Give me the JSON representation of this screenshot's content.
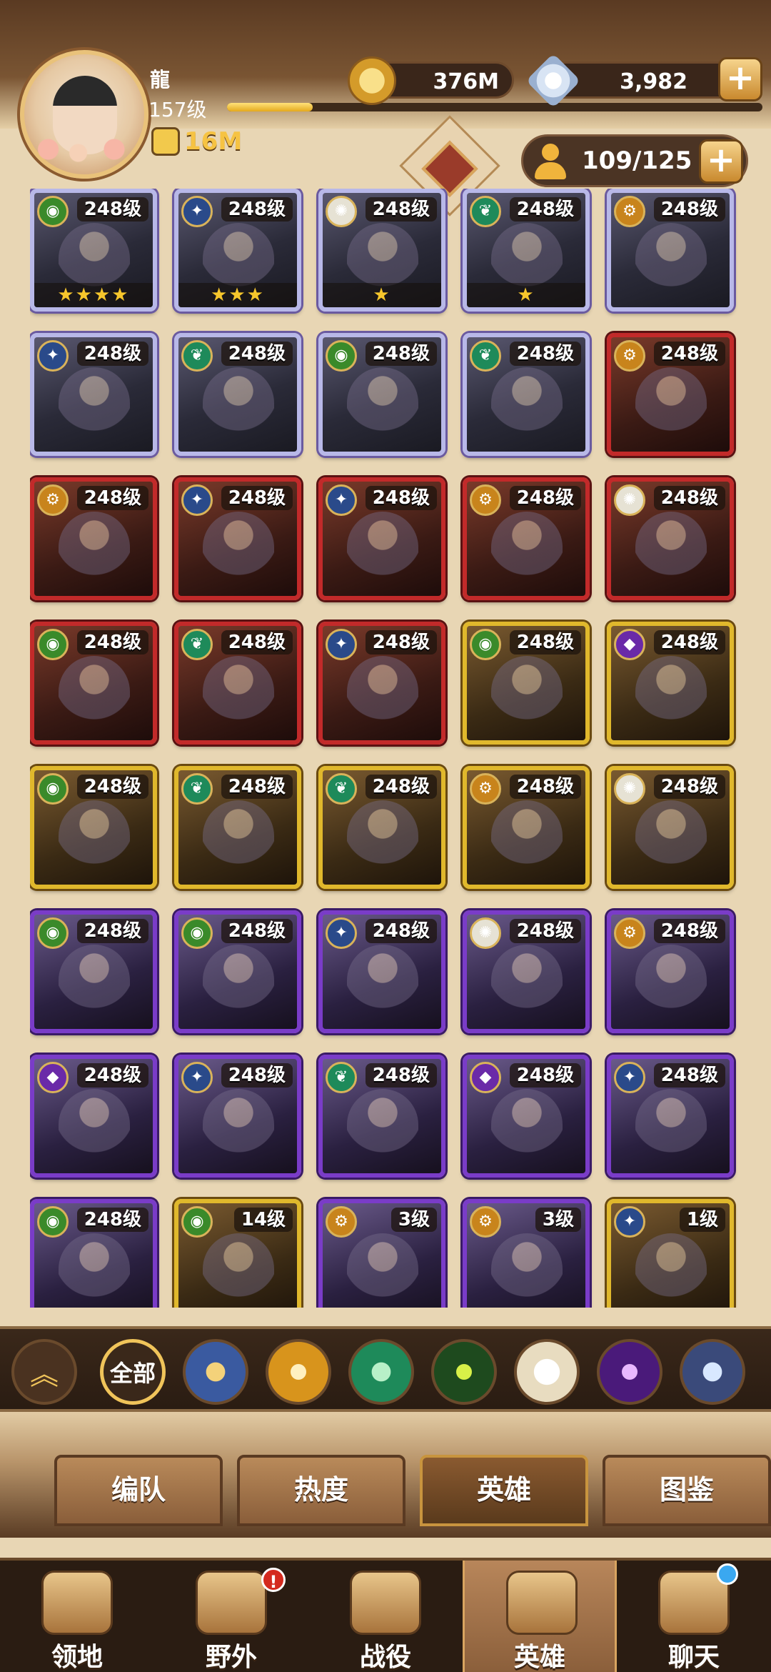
{
  "player": {
    "name": "龍",
    "level": "157级",
    "xp_progress": 0.16,
    "power": "16M"
  },
  "resources": {
    "gold": "376M",
    "diamonds": "3,982"
  },
  "hero_count": "109/125",
  "heroes": [
    {
      "level": "248级",
      "stars": "★★★★",
      "faction": "forest",
      "tier": "purple-white"
    },
    {
      "level": "248级",
      "stars": "★★★",
      "faction": "light",
      "tier": "purple-white"
    },
    {
      "level": "248级",
      "stars": "★",
      "faction": "celestial",
      "tier": "purple-white"
    },
    {
      "level": "248级",
      "stars": "★",
      "faction": "wilder",
      "tier": "purple-white"
    },
    {
      "level": "248级",
      "stars": "",
      "faction": "graveborn",
      "tier": "purple-white"
    },
    {
      "level": "248级",
      "stars": "",
      "faction": "light",
      "tier": "purple-white"
    },
    {
      "level": "248级",
      "stars": "",
      "faction": "wilder",
      "tier": "purple-white"
    },
    {
      "level": "248级",
      "stars": "",
      "faction": "forest",
      "tier": "purple-white"
    },
    {
      "level": "248级",
      "stars": "",
      "faction": "wilder",
      "tier": "purple-white"
    },
    {
      "level": "248级",
      "stars": "",
      "faction": "graveborn",
      "tier": "red"
    },
    {
      "level": "248级",
      "stars": "",
      "faction": "graveborn",
      "tier": "red"
    },
    {
      "level": "248级",
      "stars": "",
      "faction": "light",
      "tier": "red"
    },
    {
      "level": "248级",
      "stars": "",
      "faction": "light",
      "tier": "red"
    },
    {
      "level": "248级",
      "stars": "",
      "faction": "graveborn",
      "tier": "red"
    },
    {
      "level": "248级",
      "stars": "",
      "faction": "celestial",
      "tier": "red"
    },
    {
      "level": "248级",
      "stars": "",
      "faction": "forest",
      "tier": "red"
    },
    {
      "level": "248级",
      "stars": "",
      "faction": "wilder",
      "tier": "red"
    },
    {
      "level": "248级",
      "stars": "",
      "faction": "light",
      "tier": "red"
    },
    {
      "level": "248级",
      "stars": "",
      "faction": "forest",
      "tier": "gold"
    },
    {
      "level": "248级",
      "stars": "",
      "faction": "hypogean",
      "tier": "gold"
    },
    {
      "level": "248级",
      "stars": "",
      "faction": "forest",
      "tier": "gold"
    },
    {
      "level": "248级",
      "stars": "",
      "faction": "wilder",
      "tier": "gold"
    },
    {
      "level": "248级",
      "stars": "",
      "faction": "wilder",
      "tier": "gold"
    },
    {
      "level": "248级",
      "stars": "",
      "faction": "graveborn",
      "tier": "gold"
    },
    {
      "level": "248级",
      "stars": "",
      "faction": "celestial",
      "tier": "gold"
    },
    {
      "level": "248级",
      "stars": "",
      "faction": "forest",
      "tier": "purple"
    },
    {
      "level": "248级",
      "stars": "",
      "faction": "forest",
      "tier": "purple"
    },
    {
      "level": "248级",
      "stars": "",
      "faction": "light",
      "tier": "purple"
    },
    {
      "level": "248级",
      "stars": "",
      "faction": "celestial",
      "tier": "purple"
    },
    {
      "level": "248级",
      "stars": "",
      "faction": "graveborn",
      "tier": "purple"
    },
    {
      "level": "248级",
      "stars": "",
      "faction": "hypogean",
      "tier": "purple"
    },
    {
      "level": "248级",
      "stars": "",
      "faction": "light",
      "tier": "purple"
    },
    {
      "level": "248级",
      "stars": "",
      "faction": "wilder",
      "tier": "purple"
    },
    {
      "level": "248级",
      "stars": "",
      "faction": "hypogean",
      "tier": "purple"
    },
    {
      "level": "248级",
      "stars": "",
      "faction": "light",
      "tier": "purple"
    },
    {
      "level": "248级",
      "stars": "",
      "faction": "forest",
      "tier": "purple"
    },
    {
      "level": "14级",
      "stars": "",
      "faction": "forest",
      "tier": "gold"
    },
    {
      "level": "3级",
      "stars": "",
      "faction": "graveborn",
      "tier": "purple"
    },
    {
      "level": "3级",
      "stars": "",
      "faction": "graveborn",
      "tier": "purple"
    },
    {
      "level": "1级",
      "stars": "",
      "faction": "light",
      "tier": "gold"
    }
  ],
  "faction_colors": {
    "forest": "#3a8a2a",
    "light": "#2a4a8a",
    "celestial": "#e6e2d4",
    "wilder": "#1e8a5a",
    "graveborn": "#c8841c",
    "hypogean": "#6a2aa8",
    "dimensional": "#4a5a8a"
  },
  "filter": {
    "all_label": "全部",
    "factions": [
      "light",
      "graveborn",
      "wilder",
      "forest",
      "celestial",
      "hypogean",
      "dimensional"
    ]
  },
  "subtabs": [
    "编队",
    "热度",
    "英雄",
    "图鉴"
  ],
  "subtab_active": 2,
  "nav": [
    {
      "label": "领地",
      "icon": "castle-icon"
    },
    {
      "label": "野外",
      "icon": "map-scroll-icon",
      "alert": "!"
    },
    {
      "label": "战役",
      "icon": "sword-shield-icon"
    },
    {
      "label": "英雄",
      "icon": "helmet-icon"
    },
    {
      "label": "聊天",
      "icon": "chat-icon"
    }
  ],
  "nav_active": 3
}
